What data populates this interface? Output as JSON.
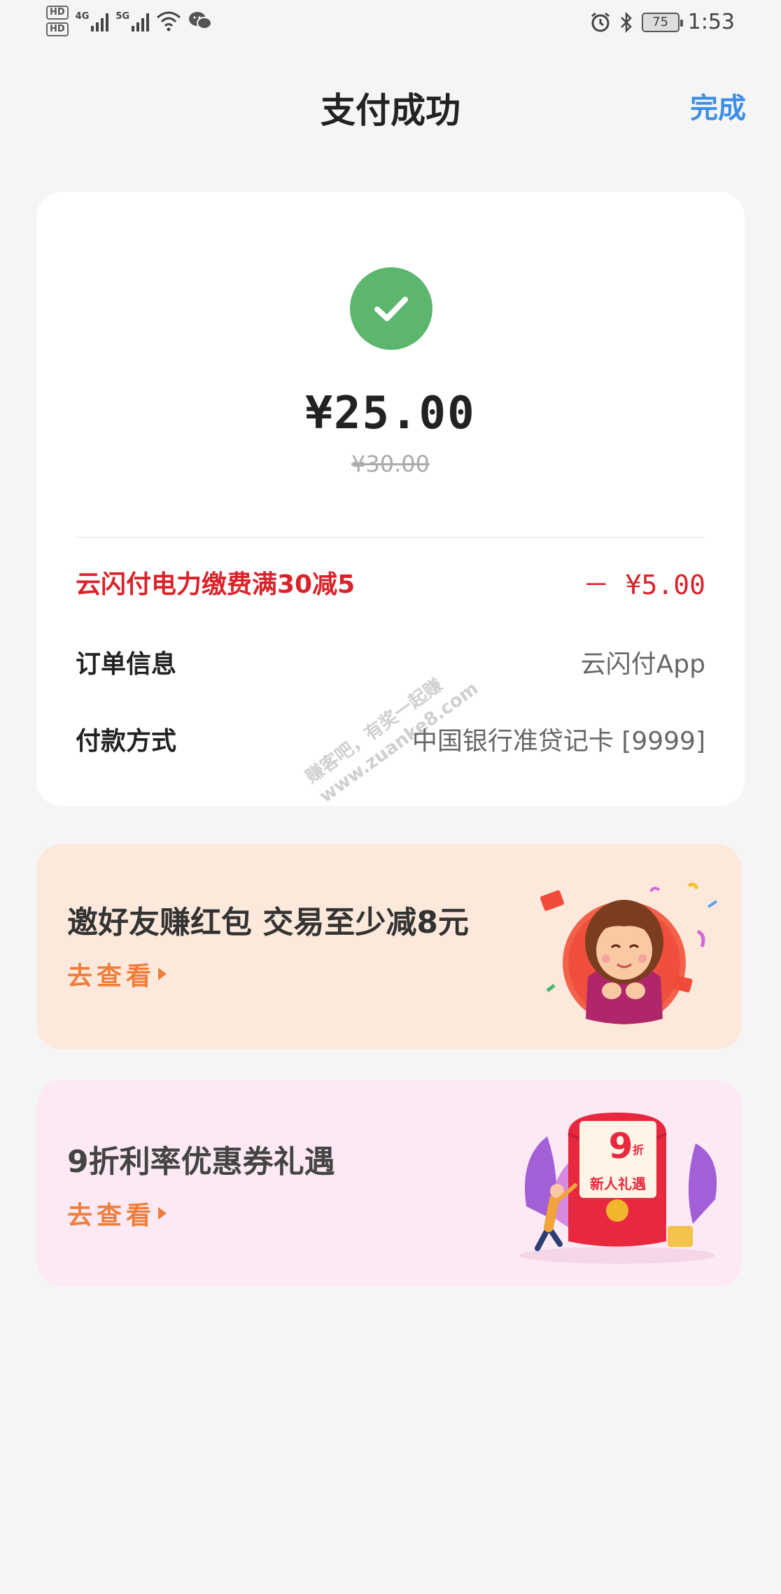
{
  "status_bar": {
    "hd1": "HD",
    "hd2": "HD",
    "net1": "4G",
    "net2": "5G",
    "battery": "75",
    "time": "1:53"
  },
  "header": {
    "title": "支付成功",
    "done_label": "完成"
  },
  "payment": {
    "amount": "¥25.00",
    "original_amount": "¥30.00",
    "status_color": "#5db66d"
  },
  "details": {
    "promo_label": "云闪付电力缴费满30减5",
    "promo_value": "－ ¥5.00",
    "order_label": "订单信息",
    "order_value": "云闪付App",
    "method_label": "付款方式",
    "method_value": "中国银行准贷记卡 [9999]"
  },
  "cards": [
    {
      "title": "邀好友赚红包 交易至少减8元",
      "link": "去查看"
    },
    {
      "title": "9折利率优惠券礼遇",
      "link": "去查看",
      "badge_number": "9",
      "badge_unit": "折",
      "badge_text": "新人礼遇"
    }
  ],
  "watermark": {
    "line1": "赚客吧，有奖一起赚",
    "line2": "www.zuanke8.com"
  },
  "colors": {
    "accent": "#3d8ee6",
    "promo_red": "#d9232a",
    "link_orange": "#f07d3b"
  }
}
